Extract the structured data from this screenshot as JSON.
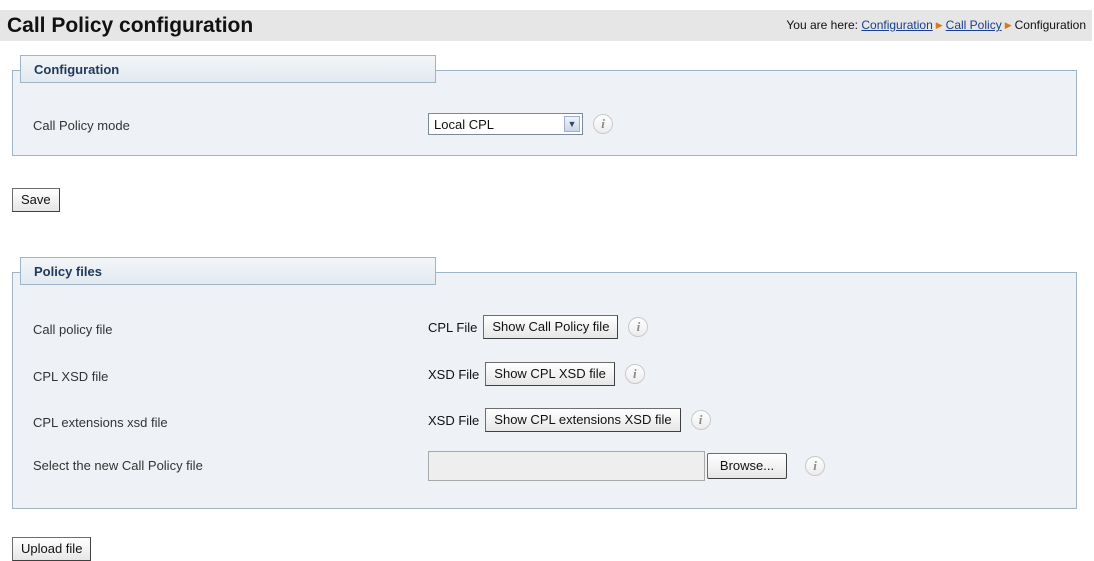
{
  "header": {
    "title": "Call Policy configuration",
    "you_are_here": "You are here:",
    "crumbs": [
      "Configuration",
      "Call Policy"
    ],
    "current": "Configuration",
    "arrow": "▶"
  },
  "configuration": {
    "heading": "Configuration",
    "mode_label": "Call Policy mode",
    "mode_value": "Local CPL",
    "info_glyph": "i"
  },
  "save_label": "Save",
  "policy_files": {
    "heading": "Policy files",
    "rows": [
      {
        "label": "Call policy file",
        "file_type": "CPL File",
        "button": "Show Call Policy file"
      },
      {
        "label": "CPL XSD file",
        "file_type": "XSD File",
        "button": "Show CPL XSD file"
      },
      {
        "label": "CPL extensions xsd file",
        "file_type": "XSD File",
        "button": "Show CPL extensions XSD file"
      }
    ],
    "select_label": "Select the new Call Policy file",
    "file_value": "",
    "browse_label": "Browse..."
  },
  "upload_label": "Upload file",
  "colors": {
    "breadcrumb_link": "#1a3f8f",
    "breadcrumb_arrow": "#d77a1b",
    "panel_bg": "#eef2f6",
    "panel_border": "#9fb4c6"
  }
}
